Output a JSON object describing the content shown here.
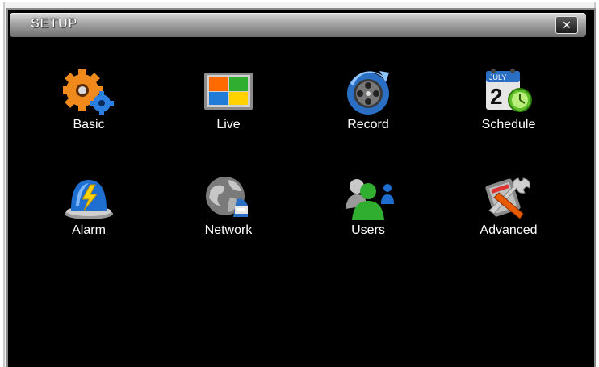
{
  "window": {
    "title": "SETUP",
    "close_label": "✕"
  },
  "menu": {
    "basic": "Basic",
    "live": "Live",
    "record": "Record",
    "schedule": "Schedule",
    "alarm": "Alarm",
    "network": "Network",
    "users": "Users",
    "advanced": "Advanced"
  },
  "calendar_icon": {
    "month": "JULY",
    "day": "2"
  }
}
